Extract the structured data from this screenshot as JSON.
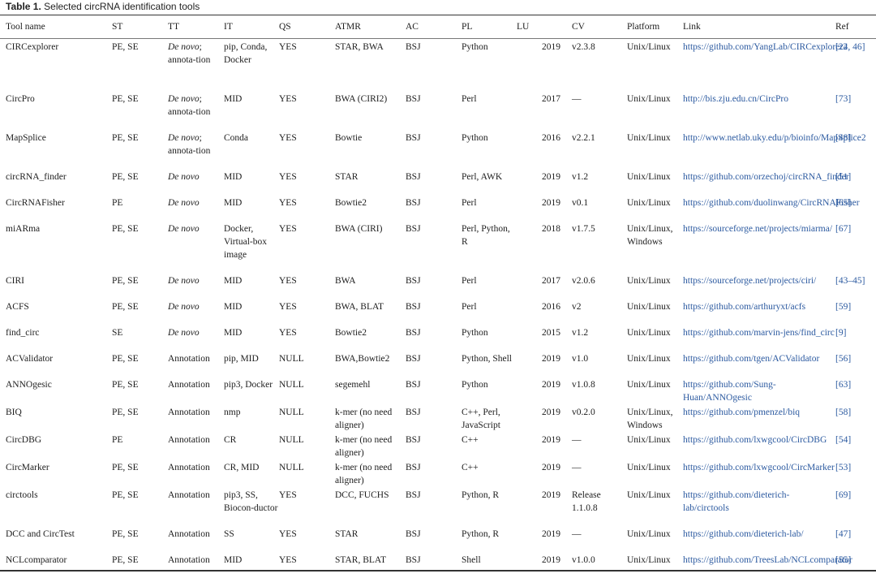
{
  "caption": {
    "label": "Table 1.",
    "text": "Selected circRNA identification tools"
  },
  "headers": [
    "Tool name",
    "ST",
    "TT",
    "IT",
    "QS",
    "ATMR",
    "AC",
    "PL",
    "LU",
    "CV",
    "Platform",
    "Link",
    "Ref"
  ],
  "rows": [
    {
      "tool": "CIRCexplorer",
      "st": "PE, SE",
      "tt": "De novo; annota-tion",
      "tt_italic_prefix": "De novo",
      "it": "pip, Conda, Docker",
      "qs": "YES",
      "atmr": "STAR, BWA",
      "ac": "BSJ",
      "pl": "Python",
      "lu": "2019",
      "cv": "v2.3.8",
      "platform": "Unix/Linux",
      "link": "https://github.com/YangLab/CIRCexplorer2",
      "ref": "[24, 46]",
      "lines": 4
    },
    {
      "tool": "CircPro",
      "st": "PE, SE",
      "tt": "De novo; annota-tion",
      "it": "MID",
      "qs": "YES",
      "atmr": "BWA (CIRI2)",
      "ac": "BSJ",
      "pl": "Perl",
      "lu": "2017",
      "cv": "—",
      "platform": "Unix/Linux",
      "link": "http://bis.zju.edu.cn/CircPro",
      "ref": "[73]",
      "lines": 3
    },
    {
      "tool": "MapSplice",
      "st": "PE, SE",
      "tt": "De novo; annota-tion",
      "it": "Conda",
      "qs": "YES",
      "atmr": "Bowtie",
      "ac": "BSJ",
      "pl": "Python",
      "lu": "2016",
      "cv": "v2.2.1",
      "platform": "Unix/Linux",
      "link": "http://www.netlab.uky.edu/p/bioinfo/MapSplice2",
      "ref": "[48]",
      "lines": 3
    },
    {
      "tool": "circRNA_finder",
      "st": "PE, SE",
      "tt": "De novo",
      "it": "MID",
      "qs": "YES",
      "atmr": "STAR",
      "ac": "BSJ",
      "pl": "Perl, AWK",
      "lu": "2019",
      "cv": "v1.2",
      "platform": "Unix/Linux",
      "link": "https://github.com/orzechoj/circRNA_finder",
      "ref": "[51]",
      "lines": 2
    },
    {
      "tool": "CircRNAFisher",
      "st": "PE",
      "tt": "De novo",
      "it": "MID",
      "qs": "YES",
      "atmr": "Bowtie2",
      "ac": "BSJ",
      "pl": "Perl",
      "lu": "2019",
      "cv": "v0.1",
      "platform": "Unix/Linux",
      "link": "https://github.com/duolinwang/CircRNAFisher",
      "ref": "[65]",
      "lines": 2
    },
    {
      "tool": "miARma",
      "st": "PE, SE",
      "tt": "De novo",
      "it": "Docker, Virtual-box image",
      "qs": "YES",
      "atmr": "BWA (CIRI)",
      "ac": "BSJ",
      "pl": "Perl, Python, R",
      "lu": "2018",
      "cv": "v1.7.5",
      "platform": "Unix/Linux, Windows",
      "link": "https://sourceforge.net/projects/miarma/",
      "ref": "[67]",
      "lines": 4
    },
    {
      "tool": "CIRI",
      "st": "PE, SE",
      "tt": "De novo",
      "it": "MID",
      "qs": "YES",
      "atmr": "BWA",
      "ac": "BSJ",
      "pl": "Perl",
      "lu": "2017",
      "cv": "v2.0.6",
      "platform": "Unix/Linux",
      "link": "https://sourceforge.net/projects/ciri/",
      "ref": "[43–45]",
      "lines": 2
    },
    {
      "tool": "ACFS",
      "st": "PE, SE",
      "tt": "De novo",
      "it": "MID",
      "qs": "YES",
      "atmr": "BWA, BLAT",
      "ac": "BSJ",
      "pl": "Perl",
      "lu": "2016",
      "cv": "v2",
      "platform": "Unix/Linux",
      "link": "https://github.com/arthuryxt/acfs",
      "ref": "[59]",
      "lines": 2
    },
    {
      "tool": "find_circ",
      "st": "SE",
      "tt": "De novo",
      "it": "MID",
      "qs": "YES",
      "atmr": "Bowtie2",
      "ac": "BSJ",
      "pl": "Python",
      "lu": "2015",
      "cv": "v1.2",
      "platform": "Unix/Linux",
      "link": "https://github.com/marvin-jens/find_circ",
      "ref": "[9]",
      "lines": 2
    },
    {
      "tool": "ACValidator",
      "st": "PE, SE",
      "tt": "Annotation",
      "it": "pip, MID",
      "qs": "NULL",
      "atmr": "BWA,Bowtie2",
      "ac": "BSJ",
      "pl": "Python, Shell",
      "lu": "2019",
      "cv": "v1.0",
      "platform": "Unix/Linux",
      "link": "https://github.com/tgen/ACValidator",
      "ref": "[56]",
      "lines": 2
    },
    {
      "tool": "ANNOgesic",
      "st": "PE, SE",
      "tt": "Annotation",
      "it": "pip3, Docker",
      "qs": "NULL",
      "atmr": "segemehl",
      "ac": "BSJ",
      "pl": "Python",
      "lu": "2019",
      "cv": "v1.0.8",
      "platform": "Unix/Linux",
      "link": "https://github.com/Sung-Huan/ANNOgesic",
      "ref": "[63]",
      "lines": 2
    },
    {
      "tool": "BIQ",
      "st": "PE, SE",
      "tt": "Annotation",
      "it": "nmp",
      "qs": "NULL",
      "atmr": "k-mer (no need aligner)",
      "ac": "BSJ",
      "pl": "C++, Perl, JavaScript",
      "lu": "2019",
      "cv": "v0.2.0",
      "platform": "Unix/Linux, Windows",
      "link": "https://github.com/pmenzel/biq",
      "ref": "[58]",
      "lines": 2
    },
    {
      "tool": "CircDBG",
      "st": "PE",
      "tt": "Annotation",
      "it": "CR",
      "qs": "NULL",
      "atmr": "k-mer (no need aligner)",
      "ac": "BSJ",
      "pl": "C++",
      "lu": "2019",
      "cv": "—",
      "platform": "Unix/Linux",
      "link": "https://github.com/lxwgcool/CircDBG",
      "ref": "[54]",
      "lines": 2
    },
    {
      "tool": "CircMarker",
      "st": "PE, SE",
      "tt": "Annotation",
      "it": "CR, MID",
      "qs": "NULL",
      "atmr": "k-mer (no need aligner)",
      "ac": "BSJ",
      "pl": "C++",
      "lu": "2019",
      "cv": "—",
      "platform": "Unix/Linux",
      "link": "https://github.com/lxwgcool/CircMarker",
      "ref": "[53]",
      "lines": 2
    },
    {
      "tool": "circtools",
      "st": "PE, SE",
      "tt": "Annotation",
      "it": "pip3, SS, Biocon-ductor",
      "qs": "YES",
      "atmr": "DCC, FUCHS",
      "ac": "BSJ",
      "pl": "Python, R",
      "lu": "2019",
      "cv": "Release 1.1.0.8",
      "platform": "Unix/Linux",
      "link": "https://github.com/dieterich-lab/circtools",
      "ref": "[69]",
      "lines": 3
    },
    {
      "tool": "DCC and CircTest",
      "st": "PE, SE",
      "tt": "Annotation",
      "it": "SS",
      "qs": "YES",
      "atmr": "STAR",
      "ac": "BSJ",
      "pl": "Python, R",
      "lu": "2019",
      "cv": "—",
      "platform": "Unix/Linux",
      "link": "https://github.com/dieterich-lab/",
      "ref": "[47]",
      "lines": 2
    },
    {
      "tool": "NCLcomparator",
      "st": "PE, SE",
      "tt": "Annotation",
      "it": "MID",
      "qs": "YES",
      "atmr": "STAR, BLAT",
      "ac": "BSJ",
      "pl": "Shell",
      "lu": "2019",
      "cv": "v1.0.0",
      "platform": "Unix/Linux",
      "link": "https://github.com/TreesLab/NCLcomparator",
      "ref": "[55]",
      "lines": 2
    }
  ]
}
